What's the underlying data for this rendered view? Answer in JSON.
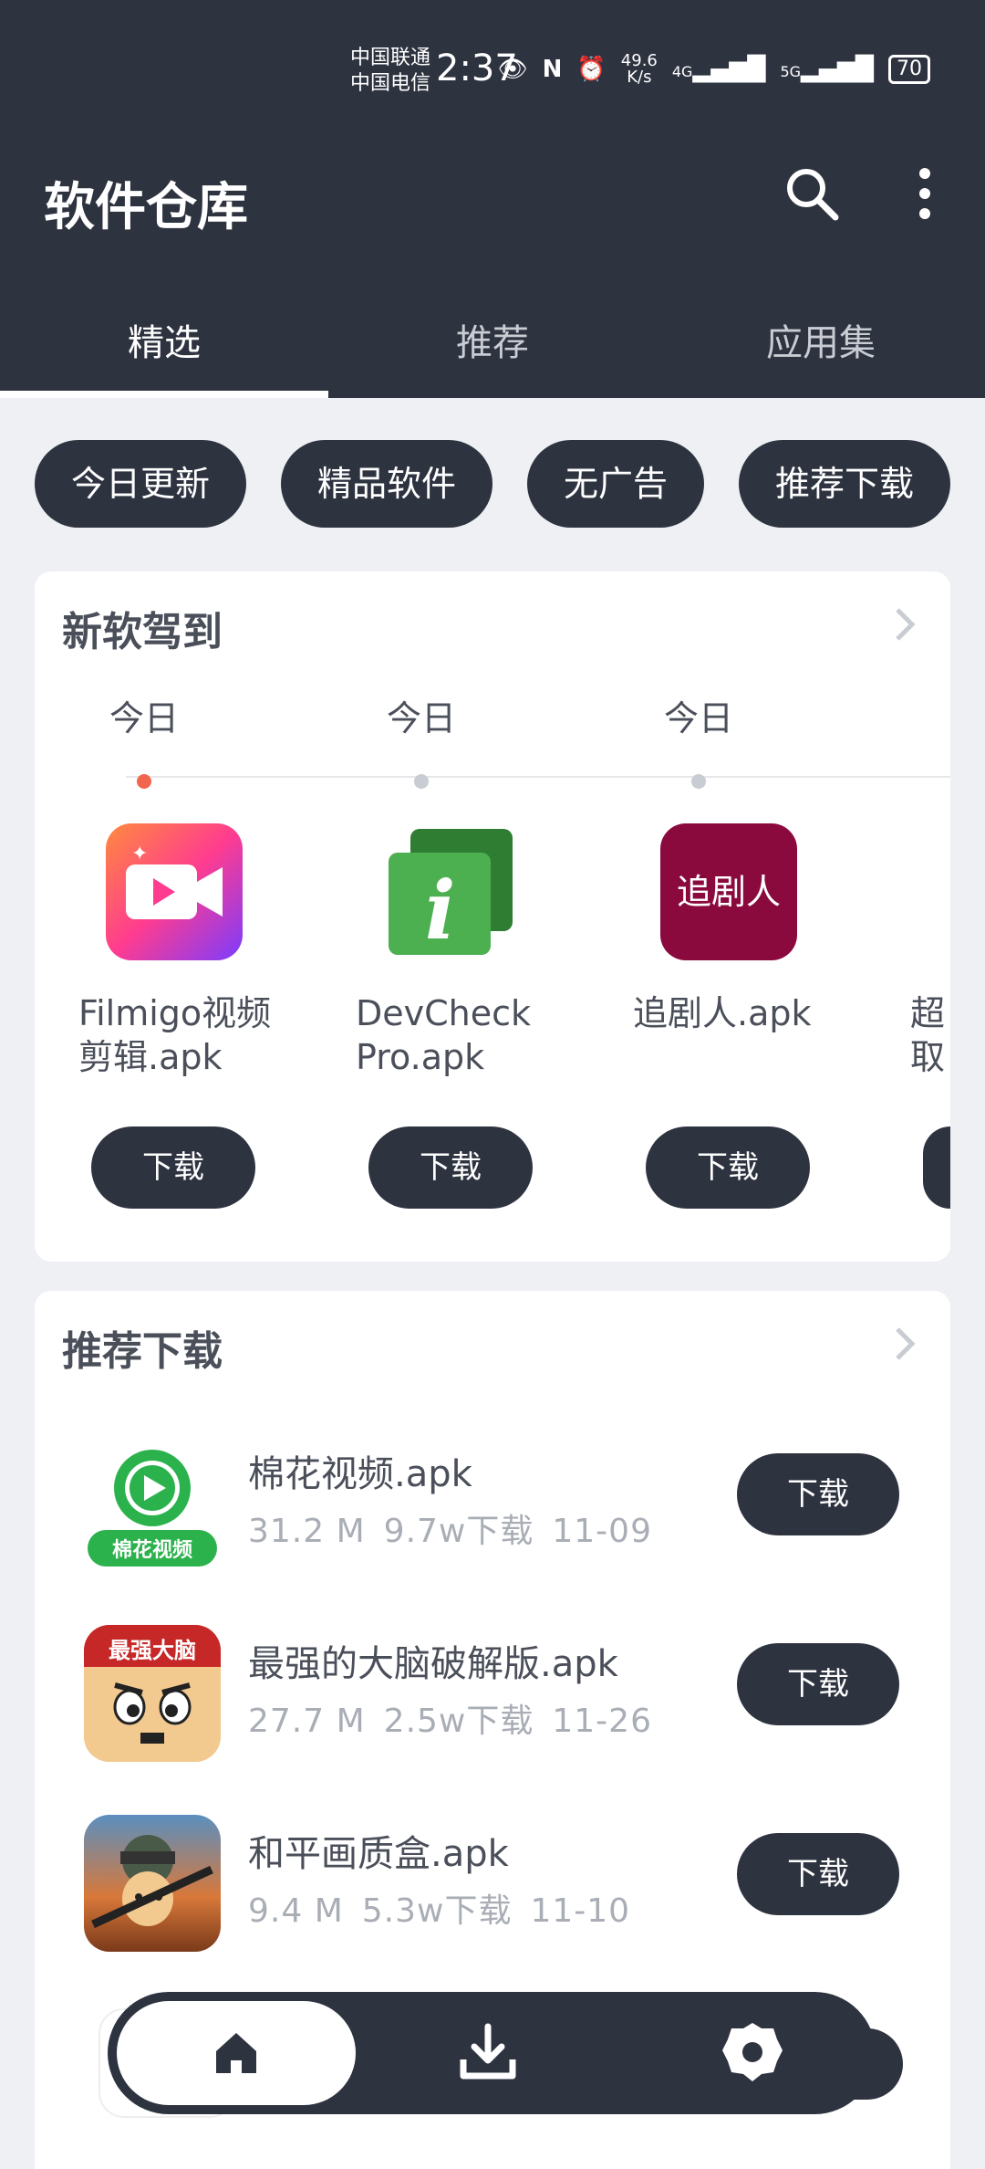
{
  "status_bar": {
    "carrier1": "中国联通",
    "carrier2": "中国电信",
    "time": "2:37",
    "speed_value": "49.6",
    "speed_unit": "K/s",
    "net1": "4G",
    "net2": "5G",
    "battery": "70"
  },
  "appbar": {
    "title": "软件仓库",
    "search_icon": "search-icon",
    "more_icon": "more-vert-icon"
  },
  "tabs": [
    {
      "label": "精选",
      "active": true
    },
    {
      "label": "推荐",
      "active": false
    },
    {
      "label": "应用集",
      "active": false
    }
  ],
  "chips": [
    "今日更新",
    "精品软件",
    "无广告",
    "推荐下载"
  ],
  "new_section": {
    "title": "新软驾到",
    "items": [
      {
        "date": "今日",
        "name": "Filmigo视频剪辑.apk",
        "button": "下载",
        "active": true
      },
      {
        "date": "今日",
        "name": "DevCheck Pro.apk",
        "button": "下载",
        "active": false
      },
      {
        "date": "今日",
        "name": "追剧人.apk",
        "button": "下载",
        "active": false
      },
      {
        "date": "",
        "name": "超取",
        "button": "",
        "active": false
      }
    ],
    "icon3_text": "追剧人"
  },
  "rec_section": {
    "title": "推荐下载",
    "items": [
      {
        "name": "棉花视频.apk",
        "size": "31.2 M",
        "downloads": "9.7w下载",
        "date": "11-09",
        "button": "下载",
        "icon_text": "棉花视频"
      },
      {
        "name": "最强的大脑破解版.apk",
        "size": "27.7 M",
        "downloads": "2.5w下载",
        "date": "11-26",
        "button": "下载",
        "icon_text": "最强大脑"
      },
      {
        "name": "和平画质盒.apk",
        "size": "9.4 M",
        "downloads": "5.3w下载",
        "date": "11-10",
        "button": "下载",
        "icon_text": ""
      }
    ]
  },
  "bottom_nav": {
    "home_icon": "home-icon",
    "download_icon": "download-icon",
    "settings_icon": "settings-icon"
  },
  "colors": {
    "primary_dark": "#2e3340",
    "accent_dot": "#f2664d",
    "background": "#eff0f4"
  }
}
